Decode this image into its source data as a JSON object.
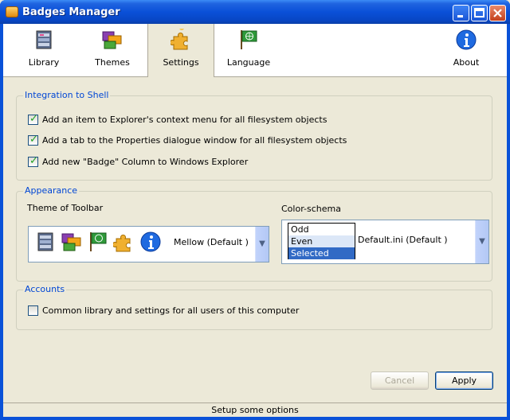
{
  "window": {
    "title": "Badges Manager"
  },
  "toolbar": {
    "items": [
      {
        "label": "Library",
        "icon": "library-icon"
      },
      {
        "label": "Themes",
        "icon": "themes-icon"
      },
      {
        "label": "Settings",
        "icon": "settings-puzzle-icon",
        "active": true
      },
      {
        "label": "Language",
        "icon": "language-flag-icon"
      },
      {
        "label": "About",
        "icon": "info-icon"
      }
    ]
  },
  "integration": {
    "title": "Integration to Shell",
    "options": [
      {
        "label": "Add an item to Explorer's context menu for all filesystem objects",
        "checked": true
      },
      {
        "label": "Add a tab to the Properties dialogue window for all filesystem objects",
        "checked": true
      },
      {
        "label": "Add new \"Badge\" Column to Windows Explorer",
        "checked": true
      }
    ]
  },
  "appearance": {
    "title": "Appearance",
    "theme_label": "Theme of Toolbar",
    "theme_value": "Mellow (Default )",
    "color_label": "Color-schema",
    "color_rows": [
      "Odd",
      "Even",
      "Selected"
    ],
    "color_value": "Default.ini (Default )"
  },
  "accounts": {
    "title": "Accounts",
    "option": {
      "label": "Common library and settings for all users of this computer",
      "checked": false
    }
  },
  "buttons": {
    "cancel": "Cancel",
    "apply": "Apply"
  },
  "status": "Setup some options",
  "colors": {
    "accent": "#0046d5",
    "titlebar": "#0a50d8",
    "selected": "#316ac5",
    "even_row": "#dce7f7"
  }
}
